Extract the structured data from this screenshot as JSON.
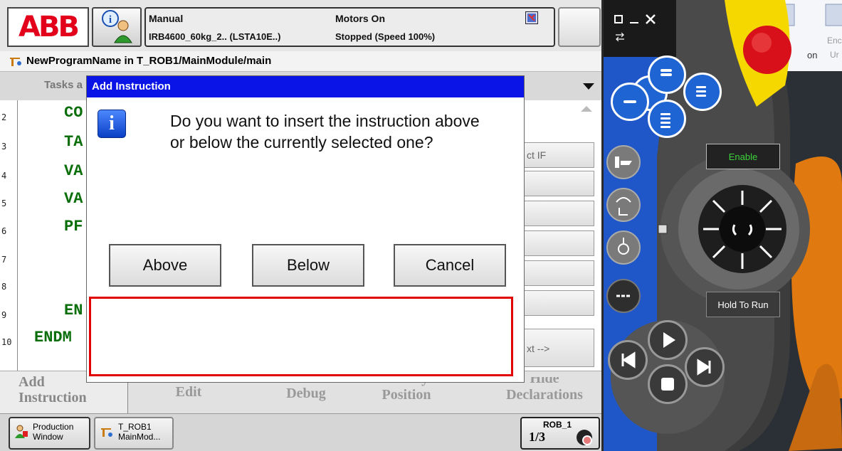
{
  "header": {
    "logo_text": "ABB",
    "mode": "Manual",
    "robot": "IRB4600_60kg_2.. (LSTA10E..)",
    "motors": "Motors On",
    "state": "Stopped (Speed 100%)"
  },
  "path": "NewProgramName in T_ROB1/MainModule/main",
  "tasks_label": "Tasks a",
  "editor": {
    "line_numbers": [
      "2",
      "3",
      "4",
      "5",
      "6",
      "7",
      "8",
      "9",
      "10"
    ],
    "code_lines": [
      "CO",
      "TA",
      "VA",
      "VA",
      "PF",
      "",
      "",
      "EN",
      "ENDM"
    ],
    "side_buttons": [
      "ct IF",
      "",
      "",
      "",
      "",
      "",
      "xt -->"
    ]
  },
  "bottom_menu": {
    "add_instruction": [
      "Add",
      "Instruction"
    ],
    "edit": "Edit",
    "debug": "Debug",
    "modify_position": [
      "Modify",
      "Position"
    ],
    "hide_declarations": [
      "Hide",
      "Declarations"
    ]
  },
  "taskbar": {
    "production_window": [
      "Production",
      "Window"
    ],
    "t_rob1": [
      "T_ROB1",
      "MainMod..."
    ],
    "rob": "ROB_1",
    "fraction": "1/3"
  },
  "dialog": {
    "title": "Add Instruction",
    "message_line1": "Do you want to insert the instruction above",
    "message_line2": "or below the currently selected one?",
    "buttons": [
      "Above",
      "Below",
      "Cancel"
    ]
  },
  "pendant": {
    "enable_label": "Enable",
    "hold_to_run_label": "Hold To Run",
    "background_text": [
      "on",
      "Enco",
      "Ur"
    ]
  },
  "colors": {
    "dialog_title_bg": "#0a14e6",
    "highlight_box": "#e00000",
    "code_green": "#0a6e0a",
    "abb_red": "#e2001a",
    "pendant_blue": "#1e64d2",
    "emergency_yellow": "#f5d800"
  }
}
